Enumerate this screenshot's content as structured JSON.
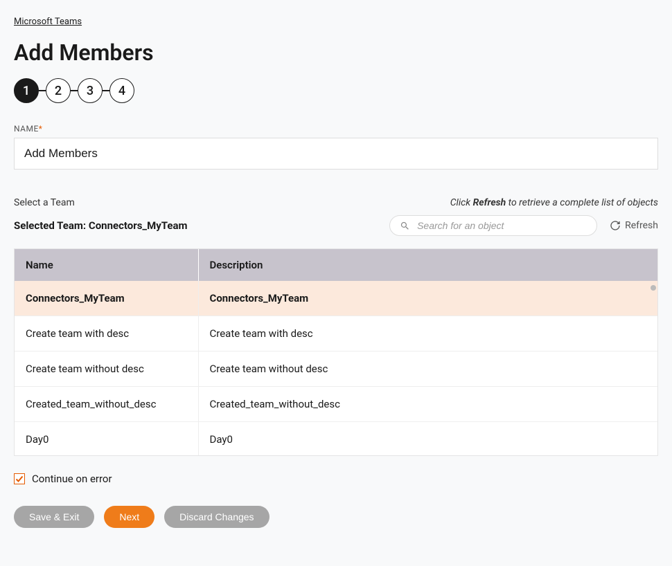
{
  "breadcrumb": "Microsoft Teams",
  "page_title": "Add Members",
  "stepper": {
    "steps": [
      "1",
      "2",
      "3",
      "4"
    ],
    "active_index": 0
  },
  "name_field": {
    "label": "NAME",
    "value": "Add Members"
  },
  "select_team": {
    "label": "Select a Team",
    "hint_prefix": "Click ",
    "hint_bold": "Refresh",
    "hint_suffix": " to retrieve a complete list of objects",
    "selected_label_prefix": "Selected Team: ",
    "selected_team": "Connectors_MyTeam"
  },
  "search": {
    "placeholder": "Search for an object"
  },
  "refresh": {
    "label": "Refresh"
  },
  "table": {
    "columns": [
      "Name",
      "Description"
    ],
    "rows": [
      {
        "name": "Connectors_MyTeam",
        "description": "Connectors_MyTeam",
        "selected": true
      },
      {
        "name": "Create team with desc",
        "description": "Create team with desc",
        "selected": false
      },
      {
        "name": "Create team without desc",
        "description": "Create team without desc",
        "selected": false
      },
      {
        "name": "Created_team_without_desc",
        "description": "Created_team_without_desc",
        "selected": false
      },
      {
        "name": "Day0",
        "description": "Day0",
        "selected": false
      }
    ]
  },
  "continue_on_error": {
    "label": "Continue on error",
    "checked": true
  },
  "buttons": {
    "save_exit": "Save & Exit",
    "next": "Next",
    "discard": "Discard Changes"
  }
}
